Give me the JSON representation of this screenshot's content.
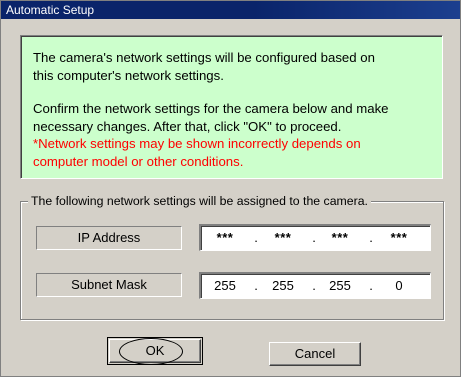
{
  "window": {
    "title": "Automatic Setup"
  },
  "info": {
    "paragraph1": [
      "The camera's network settings will be configured based on",
      "this computer's network settings."
    ],
    "paragraph2": [
      "Confirm the network settings for the camera below and make",
      "necessary changes. After that, click \"OK\" to proceed."
    ],
    "warning": [
      "*Network settings may be shown incorrectly depends on",
      "computer model or other conditions."
    ],
    "warning_color": "#ff0000",
    "panel_color": "#ccffcc"
  },
  "settings": {
    "group_label": "The following network settings will be assigned to the camera.",
    "ip_label": "IP Address",
    "ip_octets": [
      "***",
      "***",
      "***",
      "***"
    ],
    "mask_label": "Subnet Mask",
    "mask_octets": [
      "255",
      "255",
      "255",
      "0"
    ],
    "separator": "."
  },
  "buttons": {
    "ok": "OK",
    "cancel": "Cancel"
  }
}
